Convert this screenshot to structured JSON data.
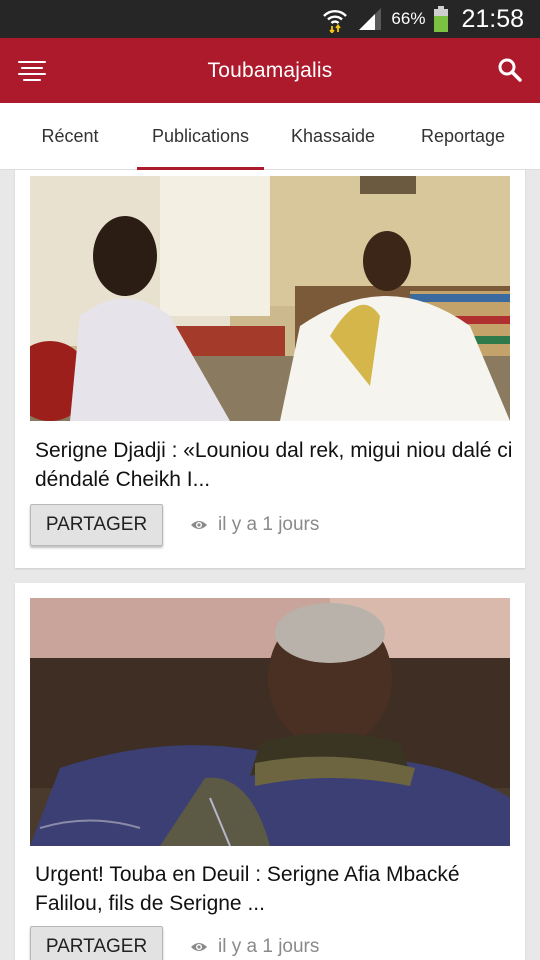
{
  "status_bar": {
    "battery_percent": "66%",
    "time": "21:58"
  },
  "app_bar": {
    "title": "Toubamajalis"
  },
  "tabs": [
    {
      "label": "Récent"
    },
    {
      "label": "Publications"
    },
    {
      "label": "Khassaide"
    },
    {
      "label": "Reportage"
    }
  ],
  "active_tab": "Publications",
  "colors": {
    "accent": "#ad1a2c",
    "status_bar": "#262626",
    "battery": "#7cc242"
  },
  "posts": [
    {
      "headline": " Serigne Djadji : «Louniou dal rek, migui niou dalé ci déndalé Cheikh I...",
      "share_label": "PARTAGER",
      "time_ago": "il y a 1 jours"
    },
    {
      "headline": " Urgent! Touba en Deuil : Serigne Afia Mbacké Falilou, fils de Serigne ...",
      "share_label": "PARTAGER",
      "time_ago": "il y a 1 jours"
    }
  ]
}
